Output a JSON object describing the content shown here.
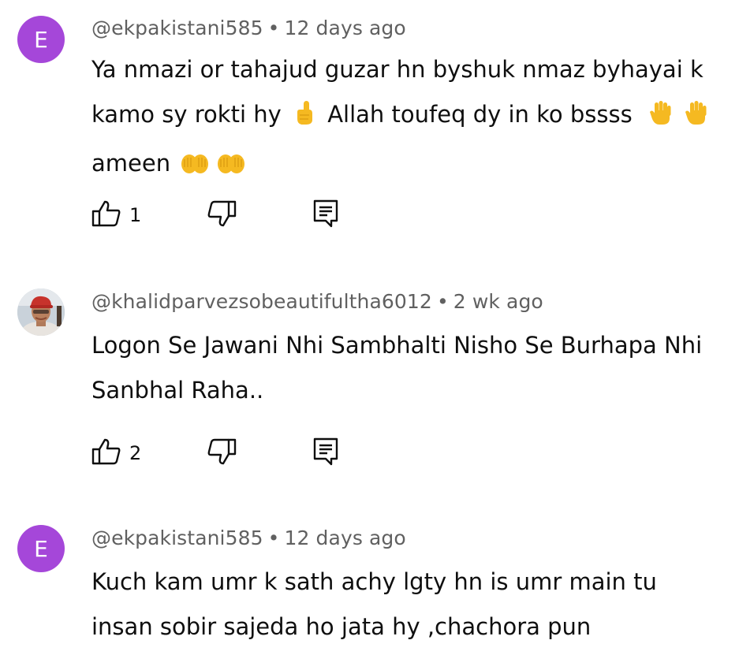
{
  "comments": [
    {
      "author": "@ekpakistani585",
      "separator": "•",
      "time": "12 days ago",
      "avatar_letter": "E",
      "avatar_color": "#a547d9",
      "text_parts": [
        "Ya nmazi or tahajud guzar hn byshuk nmaz byhayai k kamo sy rokti hy",
        "Allah toufeq dy in ko bssss",
        "ameen"
      ],
      "emojis": [
        "index-pointing-up-icon",
        "raised-hand-icon",
        "raised-hand-icon",
        "open-hands-icon",
        "open-hands-icon"
      ],
      "like_count": "1"
    },
    {
      "author": "@khalidparvezsobeautifultha6012",
      "separator": "•",
      "time": "2 wk ago",
      "avatar_type": "photo",
      "text": "Logon Se Jawani Nhi Sambhalti Nisho Se Burhapa Nhi Sanbhal Raha..",
      "like_count": "2"
    },
    {
      "author": "@ekpakistani585",
      "separator": "•",
      "time": "12 days ago",
      "avatar_letter": "E",
      "avatar_color": "#a547d9",
      "text": "Kuch kam umr k sath achy lgty hn is umr main tu insan sobir sajeda ho jata hy ,chachora pun"
    }
  ],
  "icons": {
    "like": "thumbs-up-icon",
    "dislike": "thumbs-down-icon",
    "reply": "reply-icon"
  },
  "colors": {
    "emoji_yellow": "#f5b921",
    "meta_gray": "#606060",
    "text": "#0f0f0f"
  }
}
